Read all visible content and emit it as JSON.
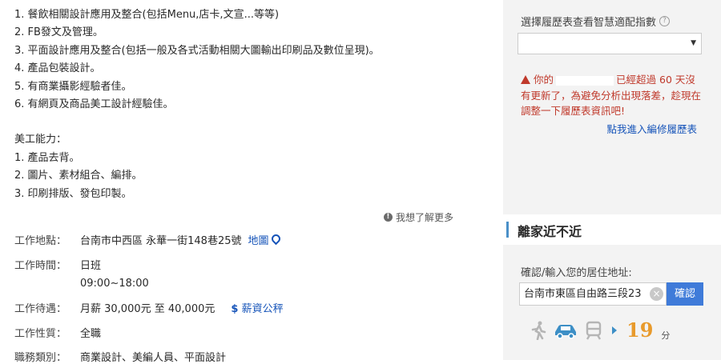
{
  "description": {
    "lines": [
      "1. 餐飲相關設計應用及整合(包括Menu,店卡,文宣...等等)",
      "2. FB發文及管理。",
      "3. 平面設計應用及整合(包括一般及各式活動相關大圖輸出印刷品及數位呈現)。",
      "4. 產品包裝設計。",
      "5. 有商業攝影經驗者佳。",
      "6. 有網頁及商品美工設計經驗佳。"
    ],
    "skills_title": "美工能力：",
    "skills": [
      "1. 產品去背。",
      "2. 圖片、素材組合、編排。",
      "3. 印刷排版、發包印製。"
    ]
  },
  "learn_more": "我想了解更多",
  "job_details": {
    "location_label": "工作地點：",
    "location_value": "台南市中西區 永華一街148巷25號",
    "map_link": "地圖",
    "time_label": "工作時間：",
    "time_value_1": "日班",
    "time_value_2": "09:00~18:00",
    "salary_label": "工作待遇：",
    "salary_value": "月薪 30,000元 至 40,000元",
    "salary_link": "薪資公秤",
    "nature_label": "工作性質：",
    "nature_value": "全職",
    "category_label": "職務類別：",
    "category_value": "商業設計、美編人員、平面設計"
  },
  "resume_panel": {
    "select_label": "選擇履歷表查看智慧適配指數",
    "warning_prefix": "你的",
    "warning_suffix": "已經超過 60 天沒",
    "warning_line2": "有更新了，為避免分析出現落差，趁現在",
    "warning_line3": "調整一下履歷表資訊吧!",
    "edit_link": "點我進入編修履歷表"
  },
  "distance": {
    "title": "離家近不近",
    "address_label": "確認/輸入您的居住地址:",
    "address_value": "台南市東區自由路三段23",
    "confirm_button": "確認",
    "minutes": "19",
    "minutes_unit": "分",
    "accent_color": "#3f7bd9",
    "minutes_color": "#e89a2c"
  }
}
